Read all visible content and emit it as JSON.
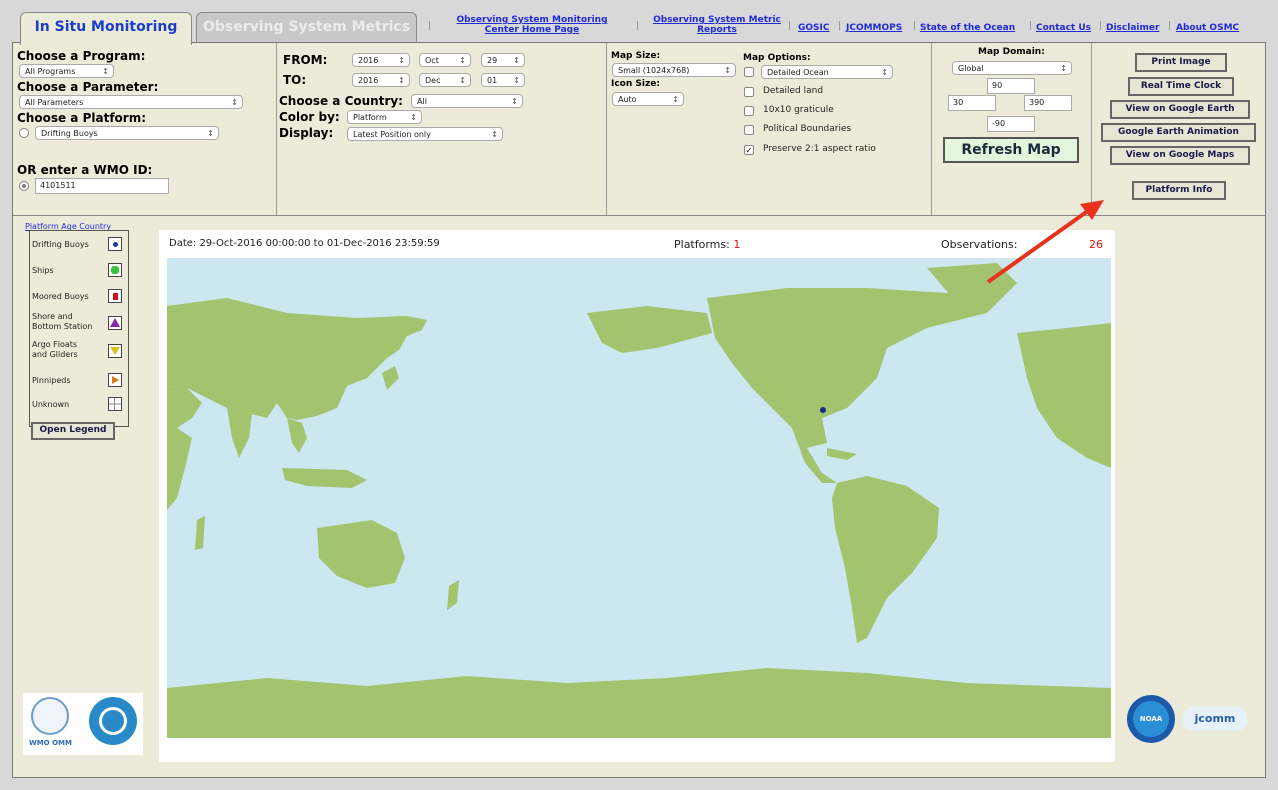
{
  "tabs": {
    "in_situ": "In Situ Monitoring",
    "observing_metrics": "Observing System Metrics"
  },
  "top_links": {
    "monitoring_home": "Observing System Monitoring Center Home Page",
    "metric_reports": "Observing System Metric Reports",
    "gosic": "GOSIC",
    "jcommops": "JCOMMOPS",
    "state_ocean": "State of the Ocean",
    "contact": "Contact Us",
    "disclaimer": "Disclaimer",
    "about": "About OSMC",
    "separator": "|"
  },
  "program": {
    "label": "Choose a Program:",
    "value": "All Programs"
  },
  "parameter": {
    "label": "Choose a Parameter:",
    "value": "All Parameters"
  },
  "platform": {
    "label": "Choose a Platform:",
    "value": "Drifting Buoys"
  },
  "wmo": {
    "label": "OR enter a WMO ID:",
    "value": "4101511"
  },
  "from": {
    "label": "FROM:",
    "year": "2016",
    "month": "Oct",
    "day": "29"
  },
  "to": {
    "label": "TO:",
    "year": "2016",
    "month": "Dec",
    "day": "01"
  },
  "country": {
    "label": "Choose a Country:",
    "value": "All"
  },
  "color_by": {
    "label": "Color by:",
    "value": "Platform"
  },
  "display": {
    "label": "Display:",
    "value": "Latest Position only"
  },
  "map_size": {
    "label": "Map Size:",
    "value": "Small (1024x768)"
  },
  "icon_size": {
    "label": "Icon Size:",
    "value": "Auto"
  },
  "map_options": {
    "label": "Map Options:",
    "detailed_ocean": "Detailed Ocean",
    "detailed_land": "Detailed land",
    "graticule": "10x10 graticule",
    "political": "Political Boundaries",
    "preserve": "Preserve 2:1 aspect ratio",
    "check_mark": "✓"
  },
  "map_domain": {
    "label": "Map Domain:",
    "value": "Global",
    "north": "90",
    "west": "30",
    "east": "390",
    "south": "-90"
  },
  "refresh_label": "Refresh Map",
  "buttons": {
    "print": "Print Image",
    "clock": "Real Time Clock",
    "google_earth": "View on Google Earth",
    "earth_anim": "Google Earth Animation",
    "google_maps": "View on Google Maps",
    "platform_info": "Platform Info"
  },
  "legend": {
    "title": "Platform Age Country",
    "items": [
      "Drifting Buoys",
      "Ships",
      "Moored Buoys",
      "Shore and Bottom Station",
      "Argo Floats and Gliders",
      "Pinnipeds",
      "Unknown"
    ],
    "open_label": "Open Legend"
  },
  "map_header": {
    "date": "Date: 29-Oct-2016 00:00:00 to 01-Dec-2016 23:59:59",
    "platforms_label": "Platforms:",
    "platforms_value": "1",
    "observations_label": "Observations:",
    "observations_value": "26"
  },
  "logos": {
    "wmo": "WMO OMM",
    "noaa": "NOAA",
    "jcomm": "jcomm"
  },
  "colors": {
    "land": "#a3c46e",
    "ocean": "#cde7f0",
    "annotation_arrow": "#e8321c",
    "link": "#1f2bd6",
    "count": "#e01010"
  }
}
